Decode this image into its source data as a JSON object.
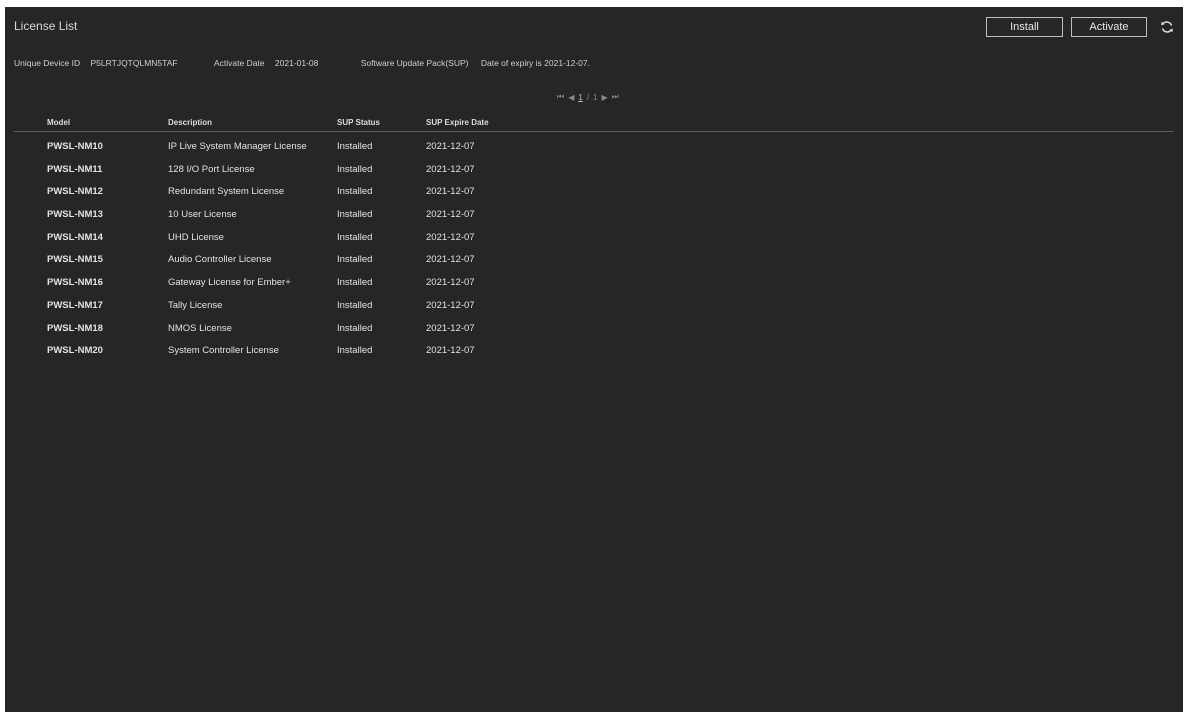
{
  "header": {
    "title": "License List",
    "install_label": "Install",
    "activate_label": "Activate",
    "refresh_icon": "refresh-icon"
  },
  "info": {
    "device_id_label": "Unique Device ID",
    "device_id_value": "P5LRTJQTQLMN5TAF",
    "activate_date_label": "Activate Date",
    "activate_date_value": "2021-01-08",
    "sup_label": "Software Update Pack(SUP)",
    "sup_expiry": "Date of expiry is 2021-12-07."
  },
  "pager": {
    "first": "⏮",
    "prev": "◀",
    "current": "1",
    "separator": "/",
    "total": "1",
    "next": "▶",
    "last": "⏭"
  },
  "table": {
    "columns": [
      "Model",
      "Description",
      "SUP Status",
      "SUP Expire Date"
    ],
    "rows": [
      {
        "model": "PWSL-NM10",
        "description": "IP Live System Manager License",
        "status": "Installed",
        "date": "2021-12-07"
      },
      {
        "model": "PWSL-NM11",
        "description": "128 I/O Port License",
        "status": "Installed",
        "date": "2021-12-07"
      },
      {
        "model": "PWSL-NM12",
        "description": "Redundant System License",
        "status": "Installed",
        "date": "2021-12-07"
      },
      {
        "model": "PWSL-NM13",
        "description": "10 User License",
        "status": "Installed",
        "date": "2021-12-07"
      },
      {
        "model": "PWSL-NM14",
        "description": "UHD License",
        "status": "Installed",
        "date": "2021-12-07"
      },
      {
        "model": "PWSL-NM15",
        "description": "Audio Controller License",
        "status": "Installed",
        "date": "2021-12-07"
      },
      {
        "model": "PWSL-NM16",
        "description": "Gateway License for Ember+",
        "status": "Installed",
        "date": "2021-12-07"
      },
      {
        "model": "PWSL-NM17",
        "description": "Tally License",
        "status": "Installed",
        "date": "2021-12-07"
      },
      {
        "model": "PWSL-NM18",
        "description": "NMOS License",
        "status": "Installed",
        "date": "2021-12-07"
      },
      {
        "model": "PWSL-NM20",
        "description": "System Controller License",
        "status": "Installed",
        "date": "2021-12-07"
      }
    ]
  },
  "colors": {
    "background": "#262626",
    "text": "#e6e6e6",
    "border": "#bdbdbd"
  }
}
